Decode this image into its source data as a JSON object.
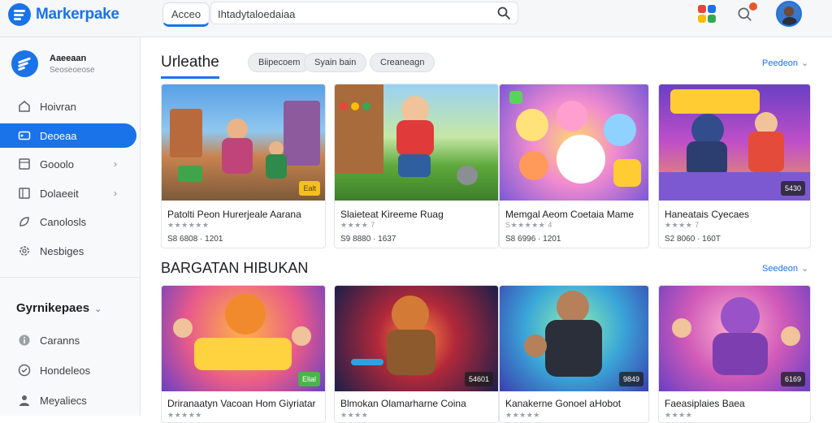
{
  "header": {
    "brand": "Markerpake",
    "tab_label": "Acceo",
    "search_value": "Ihtadytaloedaiaa"
  },
  "sidebar": {
    "account_name": "Aaeeaan",
    "account_sub": "Seoseoeose",
    "items": [
      {
        "label": "Hoivran",
        "icon": "home-icon"
      },
      {
        "label": "Deoeaa",
        "icon": "gamepad-icon",
        "active": true
      },
      {
        "label": "Gooolo",
        "icon": "apps-icon",
        "chevron": "›"
      },
      {
        "label": "Dolaeeit",
        "icon": "book-icon",
        "chevron": "›"
      },
      {
        "label": "Canolosls",
        "icon": "leaf-icon"
      },
      {
        "label": "Nesbiges",
        "icon": "gear-icon"
      }
    ],
    "section_title": "Gyrnikepaes",
    "section_items": [
      {
        "label": "Caranns",
        "icon": "info-icon"
      },
      {
        "label": "Hondeleos",
        "icon": "tag-icon"
      },
      {
        "label": "Meyaliecs",
        "icon": "people-icon"
      }
    ]
  },
  "sections": [
    {
      "title": "Urleathe",
      "chips": [
        "Biipecoem",
        "Syain bain",
        "Creaneagn"
      ],
      "see_all": "Peedeon",
      "cards": [
        {
          "title": "Patolti Peon Hurerjeale Aarana",
          "stars": "★★★★★★",
          "price": "S8 6808 · 1201",
          "badge": "Ealt",
          "badge_style": "yellow"
        },
        {
          "title": "Slaieteat Kireeme Ruag",
          "stars": "★★★★ 7",
          "price": "S9 8880 · 1637",
          "badge": "",
          "badge_style": ""
        },
        {
          "title": "Memgal Aeom Coetaia Mame",
          "stars": "S★★★★★ 4",
          "price": "S8 6996 · 1201",
          "badge": "",
          "badge_style": ""
        },
        {
          "title": "Haneatais Cyecaes",
          "stars": "★★★★ 7",
          "price": "S2 8060 · 160T",
          "badge": "5430",
          "badge_style": "dark"
        }
      ]
    },
    {
      "title": "BARGATAN HIBUKAN",
      "chips": [],
      "see_all": "Seedeon",
      "cards": [
        {
          "title": "Driranaatyn Vacoan Hom Giyriatar",
          "stars": "★★★★★",
          "price": "",
          "badge": "Elial",
          "badge_style": "green"
        },
        {
          "title": "Blmokan Olamarharne Coina",
          "stars": "★★★★",
          "price": "",
          "badge": "54601",
          "badge_style": "dark"
        },
        {
          "title": "Kanakerne Gonoel aHobot",
          "stars": "★★★★★",
          "price": "",
          "badge": "9849",
          "badge_style": "dark"
        },
        {
          "title": "Faeasiplaies Baea",
          "stars": "★★★★",
          "price": "",
          "badge": "6169",
          "badge_style": "dark"
        }
      ]
    }
  ],
  "colors": {
    "accent": "#1a73e8",
    "sidebar_bg": "#f8f9fa"
  }
}
